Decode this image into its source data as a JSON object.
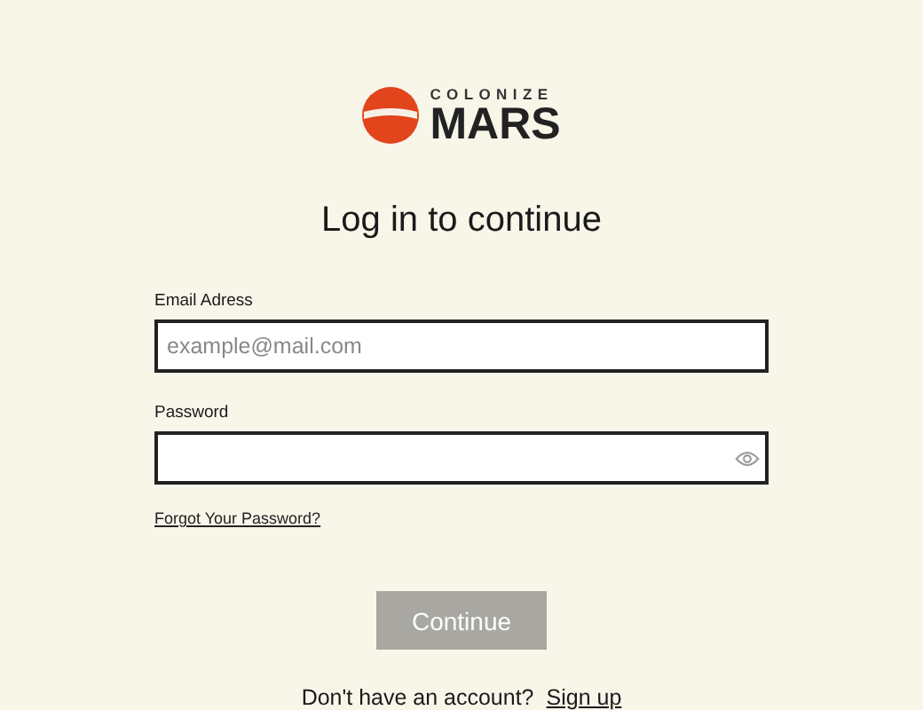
{
  "logo": {
    "top": "COLONIZE",
    "bottom": "MARS"
  },
  "title": "Log in to continue",
  "fields": [
    {
      "label": "Email Adress",
      "placeholder": "example@mail.com",
      "kind": "text"
    },
    {
      "label": "Password",
      "kind": "password"
    }
  ],
  "forgot_link": "Forgot Your Password?",
  "continue_button": {
    "label": "Continue",
    "disabled": true
  },
  "footer": {
    "text": "Don't have an account?",
    "link": "Sign up"
  }
}
